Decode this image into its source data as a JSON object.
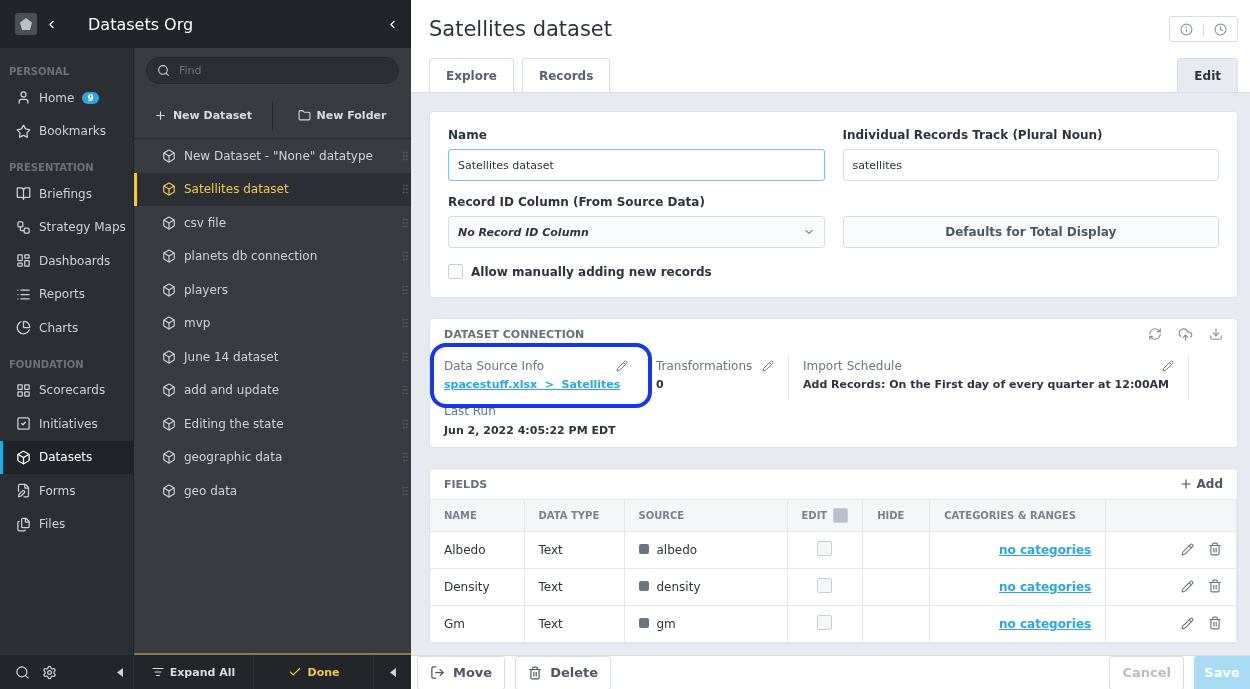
{
  "org": {
    "title": "Datasets Org"
  },
  "nav": [
    {
      "section": "PERSONAL",
      "items": [
        {
          "label": "Home",
          "badge": "9",
          "selected": false
        },
        {
          "label": "Bookmarks",
          "selected": false
        }
      ]
    },
    {
      "section": "PRESENTATION",
      "items": [
        {
          "label": "Briefings",
          "selected": false
        },
        {
          "label": "Strategy Maps",
          "selected": false
        },
        {
          "label": "Dashboards",
          "selected": false
        },
        {
          "label": "Reports",
          "selected": false
        },
        {
          "label": "Charts",
          "selected": false
        }
      ]
    },
    {
      "section": "FOUNDATION",
      "items": [
        {
          "label": "Scorecards",
          "selected": false
        },
        {
          "label": "Initiatives",
          "selected": false
        },
        {
          "label": "Datasets",
          "selected": true
        },
        {
          "label": "Forms",
          "selected": false
        },
        {
          "label": "Files",
          "selected": false
        }
      ]
    }
  ],
  "list": {
    "search_placeholder": "Find",
    "new_dataset": "New Dataset",
    "new_folder": "New Folder",
    "items": [
      {
        "label": "New Dataset - \"None\" datatype",
        "selected": false
      },
      {
        "label": "Satellites dataset",
        "selected": true
      },
      {
        "label": "csv file",
        "selected": false
      },
      {
        "label": "planets db connection",
        "selected": false
      },
      {
        "label": "players",
        "selected": false
      },
      {
        "label": "mvp",
        "selected": false
      },
      {
        "label": "June 14 dataset",
        "selected": false
      },
      {
        "label": "add and update",
        "selected": false
      },
      {
        "label": "Editing the state",
        "selected": false
      },
      {
        "label": "geographic data",
        "selected": false
      },
      {
        "label": "geo data",
        "selected": false
      }
    ],
    "expand_all": "Expand All",
    "done": "Done"
  },
  "page": {
    "title": "Satellites dataset",
    "tabs": [
      {
        "label": "Explore",
        "selected": false
      },
      {
        "label": "Records",
        "selected": false
      },
      {
        "label": "Edit",
        "selected": true
      }
    ],
    "form": {
      "name_label": "Name",
      "name_value": "Satellites dataset",
      "track_label": "Individual Records Track (Plural Noun)",
      "track_value": "satellites",
      "record_id_label": "Record ID Column (From Source Data)",
      "record_id_value": "No Record ID Column",
      "defaults_button": "Defaults for Total Display",
      "allow_manual": {
        "label": "Allow manually adding new records",
        "checked": false
      }
    },
    "connection": {
      "title": "DATASET CONNECTION",
      "data_source": {
        "label": "Data Source Info",
        "value": "spacestuff.xlsx  >  Satellites",
        "highlighted": true
      },
      "transformations": {
        "label": "Transformations",
        "value": "0"
      },
      "import_schedule": {
        "label": "Import Schedule",
        "value": "Add Records: On the First day of every quarter at 12:00AM"
      },
      "last_run": {
        "label": "Last Run",
        "value": "Jun 2, 2022 4:05:22 PM EDT"
      }
    },
    "fields": {
      "title": "FIELDS",
      "add": "Add",
      "columns": [
        "NAME",
        "DATA TYPE",
        "SOURCE",
        "EDIT",
        "HIDE",
        "CATEGORIES & RANGES"
      ],
      "edit_all_checked": false,
      "rows": [
        {
          "name": "Albedo",
          "type": "Text",
          "source": "albedo",
          "edit": false,
          "categories": "no categories"
        },
        {
          "name": "Density",
          "type": "Text",
          "source": "density",
          "edit": false,
          "categories": "no categories"
        },
        {
          "name": "Gm",
          "type": "Text",
          "source": "gm",
          "edit": false,
          "categories": "no categories"
        }
      ]
    },
    "footer": {
      "move": "Move",
      "delete": "Delete",
      "cancel": "Cancel",
      "save": "Save"
    }
  }
}
